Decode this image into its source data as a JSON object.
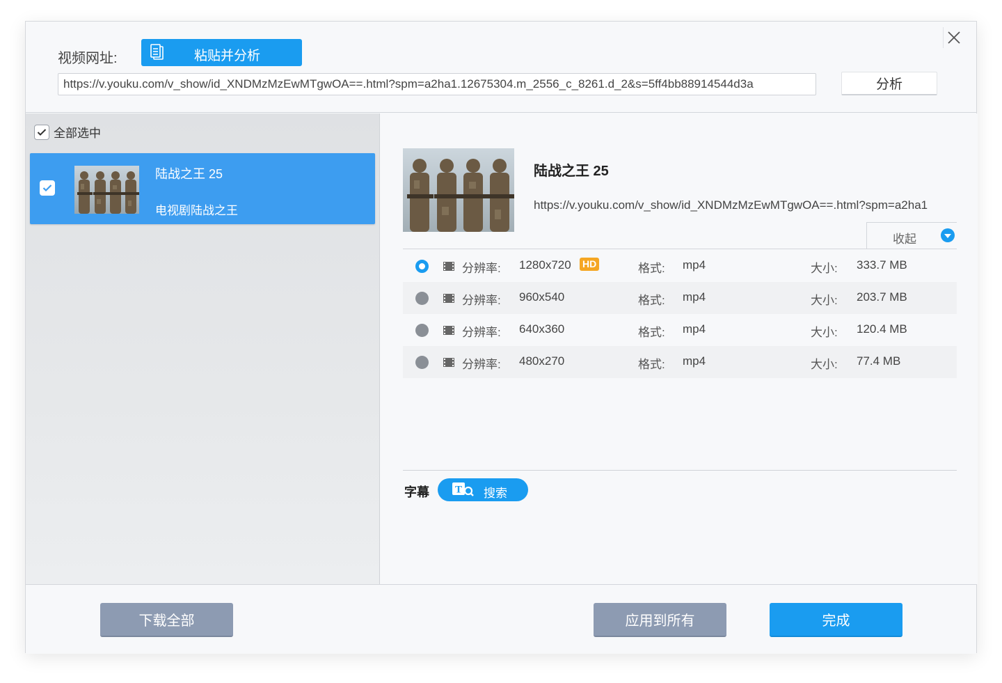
{
  "header": {
    "url_label": "视频网址:",
    "paste_button": "粘贴并分析",
    "url_value": "https://v.youku.com/v_show/id_XNDMzMzEwMTgwOA==.html?spm=a2ha1.12675304.m_2556_c_8261.d_2&s=5ff4bb88914544d3a",
    "analyze_button": "分析"
  },
  "sidebar": {
    "select_all": "全部选中",
    "items": [
      {
        "title": "陆战之王 25",
        "subtitle": "电视剧陆战之王",
        "checked": true
      }
    ]
  },
  "detail": {
    "title": "陆战之王 25",
    "url": "https://v.youku.com/v_show/id_XNDMzMzEwMTgwOA==.html?spm=a2ha1",
    "collapse_label": "收起",
    "resolution_key": "分辨率:",
    "format_key": "格式:",
    "size_key": "大小:",
    "hd_badge": "HD",
    "formats": [
      {
        "resolution": "1280x720",
        "format": "mp4",
        "size": "333.7 MB",
        "selected": true,
        "hd": true
      },
      {
        "resolution": "960x540",
        "format": "mp4",
        "size": "203.7 MB",
        "selected": false,
        "hd": false
      },
      {
        "resolution": "640x360",
        "format": "mp4",
        "size": "120.4 MB",
        "selected": false,
        "hd": false
      },
      {
        "resolution": "480x270",
        "format": "mp4",
        "size": "77.4 MB",
        "selected": false,
        "hd": false
      }
    ],
    "subtitle_label": "字幕",
    "subtitle_search": "搜索"
  },
  "footer": {
    "download_all": "下载全部",
    "apply_all": "应用到所有",
    "done": "完成"
  },
  "colors": {
    "accent": "#1a9cf0",
    "selected_item": "#3d9df0",
    "gray_button": "#8d9bb2",
    "hd_badge": "#f5a623"
  }
}
